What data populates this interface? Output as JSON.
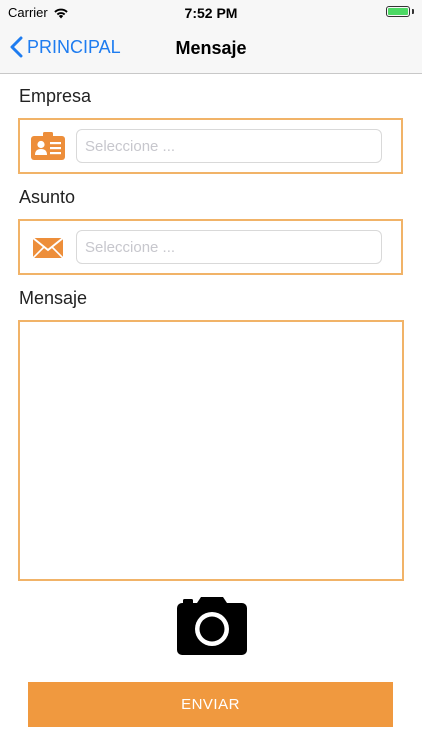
{
  "status_bar": {
    "carrier": "Carrier",
    "time": "7:52 PM"
  },
  "nav": {
    "back_label": "PRINCIPAL",
    "title": "Mensaje"
  },
  "form": {
    "empresa": {
      "label": "Empresa",
      "placeholder": "Seleccione ...",
      "value": "",
      "icon": "id-card-icon"
    },
    "asunto": {
      "label": "Asunto",
      "placeholder": "Seleccione ...",
      "value": "",
      "icon": "envelope-icon"
    },
    "mensaje": {
      "label": "Mensaje",
      "value": ""
    }
  },
  "camera_icon": "camera-icon",
  "send_label": "ENVIAR",
  "colors": {
    "accent": "#f0993f",
    "border": "#f1b368",
    "link": "#1e7cf0"
  }
}
